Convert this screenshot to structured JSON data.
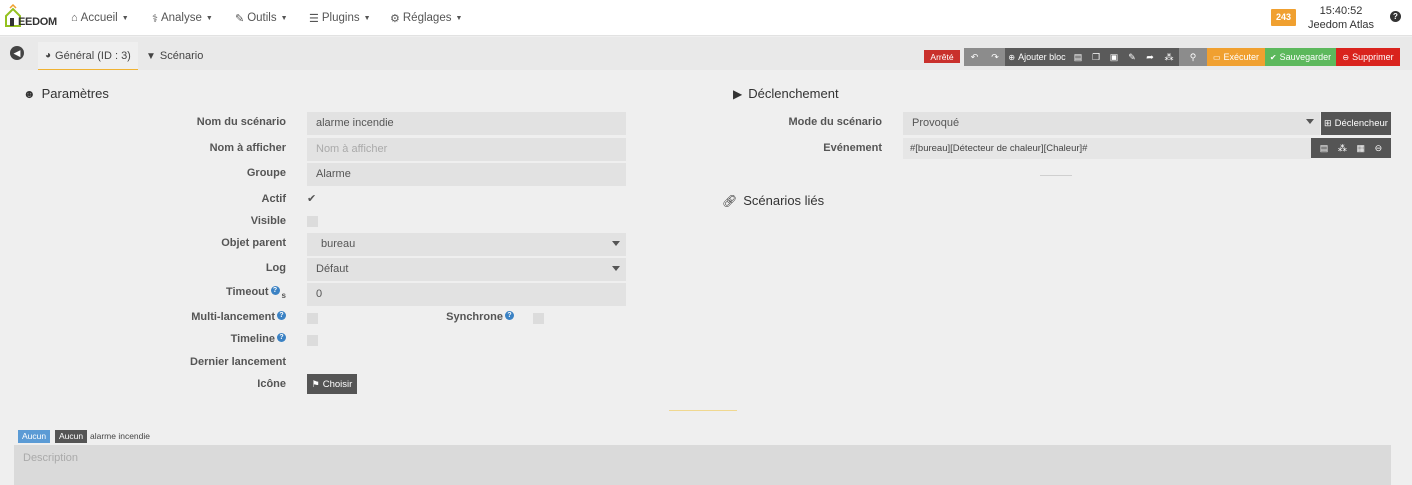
{
  "nav": {
    "logo_text": "EEDOM",
    "items": [
      {
        "label": "Accueil",
        "icon": "home-icon"
      },
      {
        "label": "Analyse",
        "icon": "analyse-icon"
      },
      {
        "label": "Outils",
        "icon": "wrench-icon"
      },
      {
        "label": "Plugins",
        "icon": "list-icon"
      },
      {
        "label": "Réglages",
        "icon": "gear-icon"
      }
    ],
    "badge": "243",
    "time": "15:40:52",
    "host": "Jeedom Atlas"
  },
  "tabs": {
    "general": "Général (ID : 3)",
    "scenario": "Scénario"
  },
  "toolbar": {
    "status": "Arrêté",
    "add_block": "Ajouter bloc",
    "execute": "Exécuter",
    "save": "Sauvegarder",
    "delete": "Supprimer"
  },
  "params": {
    "title": "Paramètres",
    "name_label": "Nom du scénario",
    "name_value": "alarme incendie",
    "display_label": "Nom à afficher",
    "display_placeholder": "Nom à afficher",
    "group_label": "Groupe",
    "group_value": "Alarme",
    "active_label": "Actif",
    "active_checked": true,
    "visible_label": "Visible",
    "parent_label": "Objet parent",
    "parent_value": "bureau",
    "log_label": "Log",
    "log_value": "Défaut",
    "timeout_label": "Timeout",
    "timeout_unit": "s",
    "timeout_value": "0",
    "multi_label": "Multi-lancement",
    "sync_label": "Synchrone",
    "timeline_label": "Timeline",
    "last_label": "Dernier lancement",
    "icon_label": "Icône",
    "choose_label": "Choisir"
  },
  "trigger": {
    "title": "Déclenchement",
    "mode_label": "Mode du scénario",
    "mode_value": "Provoqué",
    "trigger_button": "Déclencheur",
    "event_label": "Evénement",
    "event_value": "#[bureau][Détecteur de chaleur][Chaleur]#"
  },
  "linked": {
    "title": "Scénarios liés"
  },
  "footer": {
    "tag1": "Aucun",
    "tag2": "Aucun",
    "tag_text": "alarme incendie",
    "description_placeholder": "Description"
  }
}
